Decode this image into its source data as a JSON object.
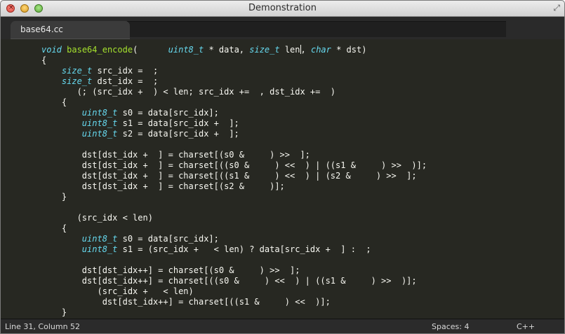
{
  "window": {
    "title": "Demonstration"
  },
  "tabs": [
    {
      "label": "base64.cc"
    }
  ],
  "code_lines": [
    [
      {
        "t": "void",
        "c": "kw"
      },
      {
        "t": " "
      },
      {
        "t": "base64_encode",
        "c": "fn"
      },
      {
        "t": "(      "
      },
      {
        "t": "uint8_t",
        "c": "kw"
      },
      {
        "t": " * data, "
      },
      {
        "t": "size_t",
        "c": "kw"
      },
      {
        "t": " len"
      },
      {
        "t": "",
        "c": "cursor"
      },
      {
        "t": ", "
      },
      {
        "t": "char",
        "c": "kw"
      },
      {
        "t": " * dst)"
      }
    ],
    [
      {
        "t": "{"
      }
    ],
    [
      {
        "t": "    "
      },
      {
        "t": "size_t",
        "c": "kw"
      },
      {
        "t": " src_idx =  ;"
      }
    ],
    [
      {
        "t": "    "
      },
      {
        "t": "size_t",
        "c": "kw"
      },
      {
        "t": " dst_idx =  ;"
      }
    ],
    [
      {
        "t": "       (; (src_idx +  ) < len; src_idx +=  , dst_idx +=  )"
      }
    ],
    [
      {
        "t": "    {"
      }
    ],
    [
      {
        "t": "        "
      },
      {
        "t": "uint8_t",
        "c": "kw"
      },
      {
        "t": " s0 = data[src_idx];"
      }
    ],
    [
      {
        "t": "        "
      },
      {
        "t": "uint8_t",
        "c": "kw"
      },
      {
        "t": " s1 = data[src_idx +  ];"
      }
    ],
    [
      {
        "t": "        "
      },
      {
        "t": "uint8_t",
        "c": "kw"
      },
      {
        "t": " s2 = data[src_idx +  ];"
      }
    ],
    [
      {
        "t": ""
      }
    ],
    [
      {
        "t": "        dst[dst_idx +  ] = charset[(s0 &     ) >>  ];"
      }
    ],
    [
      {
        "t": "        dst[dst_idx +  ] = charset[((s0 &     ) <<  ) | ((s1 &     ) >>  )];"
      }
    ],
    [
      {
        "t": "        dst[dst_idx +  ] = charset[((s1 &     ) <<  ) | (s2 &     ) >>  ];"
      }
    ],
    [
      {
        "t": "        dst[dst_idx +  ] = charset[(s2 &     )];"
      }
    ],
    [
      {
        "t": "    }"
      }
    ],
    [
      {
        "t": ""
      }
    ],
    [
      {
        "t": "       (src_idx < len)"
      }
    ],
    [
      {
        "t": "    {"
      }
    ],
    [
      {
        "t": "        "
      },
      {
        "t": "uint8_t",
        "c": "kw"
      },
      {
        "t": " s0 = data[src_idx];"
      }
    ],
    [
      {
        "t": "        "
      },
      {
        "t": "uint8_t",
        "c": "kw"
      },
      {
        "t": " s1 = (src_idx +   < len) ? data[src_idx +  ] :  ;"
      }
    ],
    [
      {
        "t": ""
      }
    ],
    [
      {
        "t": "        dst[dst_idx++] = charset[(s0 &     ) >>  ];"
      }
    ],
    [
      {
        "t": "        dst[dst_idx++] = charset[((s0 &     ) <<  ) | ((s1 &     ) >>  )];"
      }
    ],
    [
      {
        "t": "           (src_idx +   < len)"
      }
    ],
    [
      {
        "t": "            dst[dst_idx++] = charset[((s1 &     ) <<  )];"
      }
    ],
    [
      {
        "t": "    }"
      }
    ]
  ],
  "status": {
    "position": "Line 31, Column 52",
    "spaces": "Spaces: 4",
    "syntax": "C++"
  },
  "colors": {
    "background": "#272822",
    "text": "#f8f8f2",
    "keyword": "#66d9ef",
    "function": "#a6e22e"
  },
  "icons": {
    "close": "close-icon",
    "minimize": "minimize-icon",
    "zoom": "zoom-icon",
    "fullscreen": "fullscreen-icon"
  }
}
